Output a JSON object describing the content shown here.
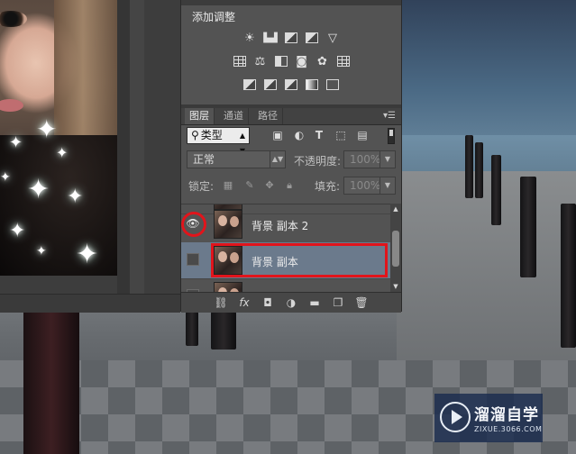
{
  "adjustments": {
    "title": "添加调整",
    "row1": [
      "brightness-contrast-icon",
      "levels-icon",
      "curves-icon",
      "exposure-icon",
      "vibrance-icon"
    ],
    "row2": [
      "hue-saturation-icon",
      "color-balance-icon",
      "black-white-icon",
      "photo-filter-icon",
      "channel-mixer-icon",
      "color-lookup-icon"
    ],
    "row3": [
      "invert-icon",
      "posterize-icon",
      "threshold-icon",
      "gradient-map-icon",
      "selective-color-icon"
    ]
  },
  "layers_panel": {
    "tabs": [
      "图层",
      "通道",
      "路径"
    ],
    "active_tab": "图层",
    "filter_kind": "类型",
    "blend_mode": "正常",
    "opacity_label": "不透明度:",
    "opacity_value": "100%",
    "lock_label": "锁定:",
    "fill_label": "填充:",
    "fill_value": "100%",
    "layers": [
      {
        "name": "背景 副本 2",
        "visible": true,
        "selected": false
      },
      {
        "name": "背景 副本",
        "visible": false,
        "selected": true
      },
      {
        "name": "",
        "visible": false,
        "selected": false
      }
    ],
    "footer_icons": [
      "link-icon",
      "fx-icon",
      "mask-icon",
      "adjustment-icon",
      "group-folder-icon",
      "new-layer-icon",
      "trash-icon"
    ]
  },
  "watermark": {
    "title": "溜溜自学",
    "subtitle": "ZIXUE.3066.COM"
  },
  "colors": {
    "panel_bg": "#535353",
    "selected_layer": "#6b7a8c",
    "highlight_red": "#e1141b"
  }
}
